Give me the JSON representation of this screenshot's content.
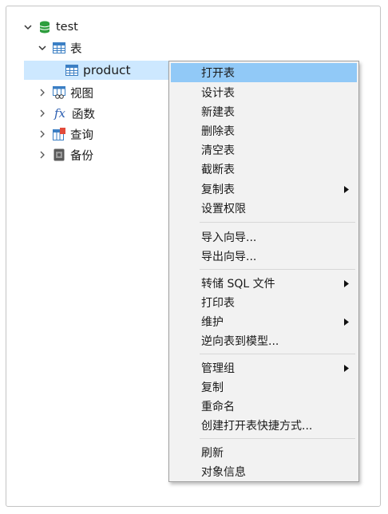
{
  "tree": {
    "connection": {
      "label": "test",
      "icon": "database-icon"
    },
    "tables": {
      "label": "表",
      "icon": "table-icon"
    },
    "product": {
      "label": "product",
      "icon": "table-icon"
    },
    "views": {
      "label": "视图",
      "icon": "view-icon"
    },
    "functions": {
      "label": "函数",
      "icon": "function-icon"
    },
    "queries": {
      "label": "查询",
      "icon": "query-icon"
    },
    "backups": {
      "label": "备份",
      "icon": "backup-icon"
    },
    "function_glyph": "fx"
  },
  "context_menu": {
    "items": [
      {
        "label": "打开表"
      },
      {
        "label": "设计表"
      },
      {
        "label": "新建表"
      },
      {
        "label": "删除表"
      },
      {
        "label": "清空表"
      },
      {
        "label": "截断表"
      },
      {
        "label": "复制表",
        "submenu": true
      },
      {
        "label": "设置权限"
      },
      {
        "label": "导入向导..."
      },
      {
        "label": "导出向导..."
      },
      {
        "label": "转储 SQL 文件",
        "submenu": true
      },
      {
        "label": "打印表"
      },
      {
        "label": "维护",
        "submenu": true
      },
      {
        "label": "逆向表到模型..."
      },
      {
        "label": "管理组",
        "submenu": true
      },
      {
        "label": "复制"
      },
      {
        "label": "重命名"
      },
      {
        "label": "创建打开表快捷方式..."
      },
      {
        "label": "刷新"
      },
      {
        "label": "对象信息"
      }
    ],
    "hovered_item": "打开表"
  },
  "colors": {
    "selection": "#cde8ff",
    "menu_hover": "#91c9f7",
    "database_green": "#2e9e3e",
    "table_blue": "#3b7fc4"
  }
}
